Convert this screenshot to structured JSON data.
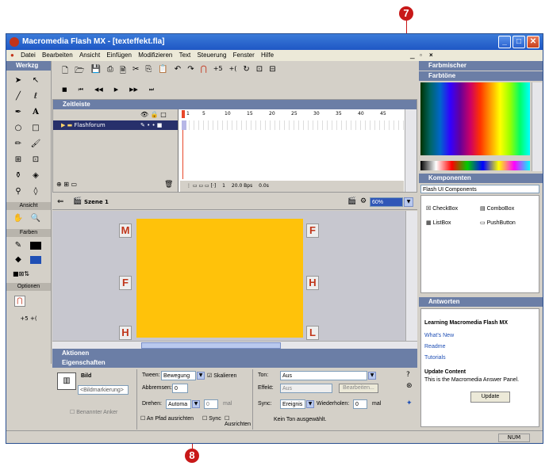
{
  "callouts": {
    "top": "7",
    "bottom": "8"
  },
  "window": {
    "title": "Macromedia Flash MX - [texteffekt.fla]",
    "min": "_",
    "max": "□",
    "close": "✕"
  },
  "menu": [
    "Datei",
    "Bearbeiten",
    "Ansicht",
    "Einfügen",
    "Modifizieren",
    "Text",
    "Steuerung",
    "Fenster",
    "Hilfe"
  ],
  "tools": {
    "title": "Werkzg",
    "sections": {
      "view": "Ansicht",
      "colors": "Farben",
      "options": "Optionen"
    }
  },
  "timeline": {
    "title": "Zeitleiste",
    "layer": "Flashforum",
    "frame_ticks": [
      "1",
      "5",
      "10",
      "15",
      "20",
      "25",
      "30",
      "35",
      "40",
      "45"
    ],
    "current_frame": "1",
    "fps": "20.0 Bps",
    "time": "0.0s"
  },
  "scene": {
    "label": "Szene 1",
    "zoom": "60%"
  },
  "stage_letters": [
    "M",
    "F",
    "F",
    "H",
    "H",
    "L"
  ],
  "panels": {
    "aktionen": "Aktionen",
    "eigenschaften": "Eigenschaften",
    "farbmischer": "Farbmischer",
    "farbtoene": "Farbtöne",
    "komponenten": "Komponenten",
    "antworten": "Antworten"
  },
  "properties": {
    "bild": "Bild",
    "bild_field": "<Bildmarkierung>",
    "tween_label": "Tween:",
    "tween_value": "Bewegung",
    "skalieren": "Skalieren",
    "abbremsen_label": "Abbremsen:",
    "abbremsen_value": "0",
    "benannter_anker": "Benannter Anker",
    "drehen_label": "Drehen:",
    "drehen_value": "Automa",
    "drehen_num": "0",
    "mal1": "mal",
    "an_pfad": "An Pfad ausrichten",
    "sync": "Sync",
    "ausrichten": "Ausrichten",
    "ton_label": "Ton:",
    "ton_value": "Aus",
    "effekt_label": "Effekt:",
    "effekt_value": "Aus",
    "bearbeiten": "Bearbeiten...",
    "sync_label": "Sync:",
    "sync_value": "Ereignis",
    "wiederholen_label": "Wiederholen:",
    "wiederholen_value": "0",
    "mal2": "mal",
    "kein_ton": "Kein Ton ausgewählt."
  },
  "components": {
    "dropdown": "Flash UI Components",
    "items": [
      "CheckBox",
      "ComboBox",
      "ListBox",
      "PushButton"
    ]
  },
  "answers": {
    "heading": "Learning Macromedia Flash MX",
    "links": [
      "What's New",
      "Readme",
      "Tutorials"
    ],
    "update_heading": "Update Content",
    "update_text": "This is the Macromedia Answer Panel.",
    "update_button": "Update"
  },
  "status": {
    "num": "NUM"
  },
  "colors": {
    "stage": "#ffc20a",
    "accent": "#c81818",
    "titlebar": "#1f57c5"
  }
}
